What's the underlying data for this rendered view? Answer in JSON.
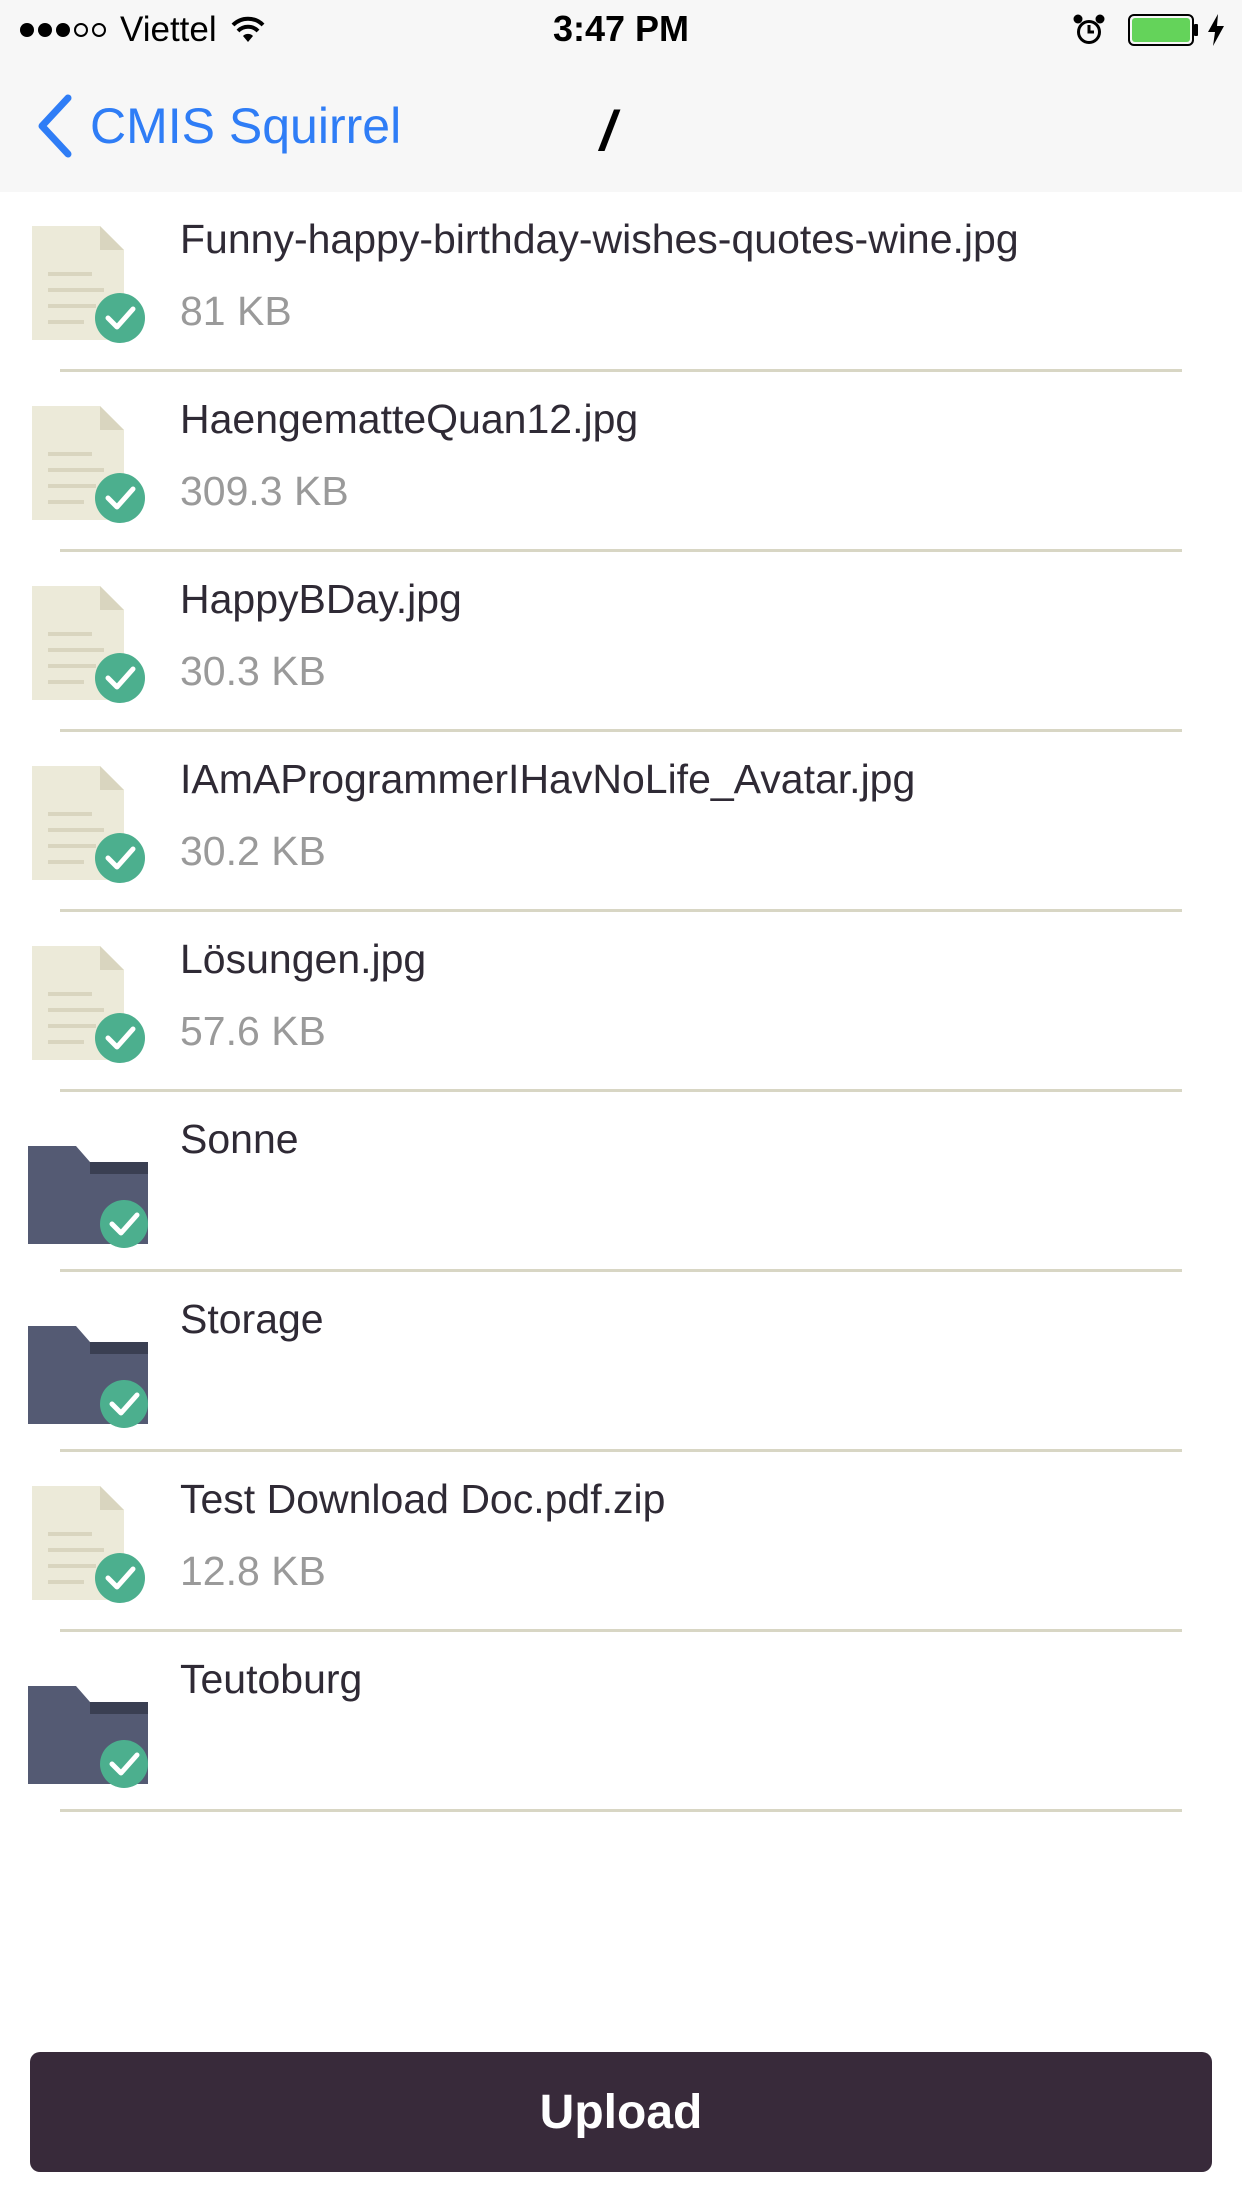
{
  "status_bar": {
    "signal_dots": [
      "on",
      "on",
      "on",
      "off",
      "off"
    ],
    "carrier": "Viettel",
    "time": "3:47 PM",
    "icons": [
      "wifi-icon",
      "alarm-icon",
      "battery-icon",
      "charging-icon"
    ]
  },
  "nav": {
    "back_label": "CMIS Squirrel",
    "back_icon": "chevron-left-icon",
    "title": "/"
  },
  "colors": {
    "accent": "#2f7df6",
    "check": "#4caf8e",
    "folder": "#545a73",
    "document": "#ecead9",
    "upload_bg": "#382a3a",
    "divider": "#d8d6c4"
  },
  "items": [
    {
      "type": "document",
      "name": "Funny-happy-birthday-wishes-quotes-wine.jpg",
      "size": "81 KB"
    },
    {
      "type": "document",
      "name": "HaengematteQuan12.jpg",
      "size": "309.3 KB"
    },
    {
      "type": "document",
      "name": "HappyBDay.jpg",
      "size": "30.3 KB"
    },
    {
      "type": "document",
      "name": "IAmAProgrammerIHavNoLife_Avatar.jpg",
      "size": "30.2 KB"
    },
    {
      "type": "document",
      "name": "Lösungen.jpg",
      "size": "57.6 KB"
    },
    {
      "type": "folder",
      "name": "Sonne",
      "size": ""
    },
    {
      "type": "folder",
      "name": "Storage",
      "size": ""
    },
    {
      "type": "document",
      "name": "Test Download Doc.pdf.zip",
      "size": "12.8 KB"
    },
    {
      "type": "folder",
      "name": "Teutoburg",
      "size": ""
    }
  ],
  "upload": {
    "label": "Upload"
  }
}
